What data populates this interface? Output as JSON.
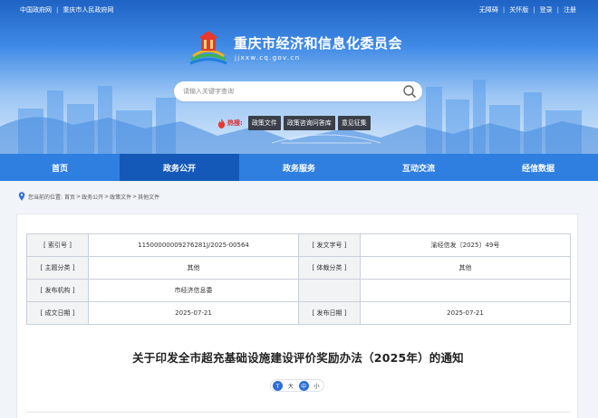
{
  "topbar": {
    "left_links": [
      "中国政府网",
      "重庆市人民政府网"
    ],
    "right_links": [
      "无障碍",
      "关怀版",
      "登录",
      "注册"
    ]
  },
  "site": {
    "title": "重庆市经济和信息化委员会",
    "url": "jjxxw.cq.gov.cn"
  },
  "search": {
    "placeholder": "请输入关键字查询",
    "icon": "search-icon"
  },
  "hot": {
    "label": "热搜:",
    "icon": "flame-icon",
    "tags": [
      "政策文件",
      "政策咨询问答库",
      "意见征集"
    ]
  },
  "nav": {
    "items": [
      "首页",
      "政务公开",
      "政务服务",
      "互动交流",
      "经信数据"
    ],
    "active_index": 1
  },
  "breadcrumb": {
    "prefix": "您当前的位置:",
    "items": [
      "首页",
      "政务公开",
      "政策文件",
      "其他文件"
    ],
    "separator": ">"
  },
  "meta": {
    "rows": [
      [
        "[ 索引号 ]",
        "115000000092762​81J/2025-00564",
        "[ 发文字号 ]",
        "渝经信发〔2025〕49号"
      ],
      [
        "[ 主题分类 ]",
        "其他",
        "[ 体裁分类 ]",
        "其他"
      ],
      [
        "[ 发布机构 ]",
        "市经济信息委",
        "",
        ""
      ],
      [
        "[ 成文日期 ]",
        "2025-07-21",
        "[ 发布日期 ]",
        "2025-07-21"
      ]
    ]
  },
  "document": {
    "title": "关于印发全市超充基础设施建设评价奖励办法（2025年）的通知"
  },
  "font_size": {
    "options": [
      "大",
      "中",
      "小"
    ],
    "active_index": 1
  },
  "colors": {
    "nav": "#2f7fe0",
    "nav_active": "#1559b8",
    "hot_label": "#e02a2a",
    "hot_tag_bg": "#3a3f49",
    "fontsize_active": "#2d6fd6"
  }
}
